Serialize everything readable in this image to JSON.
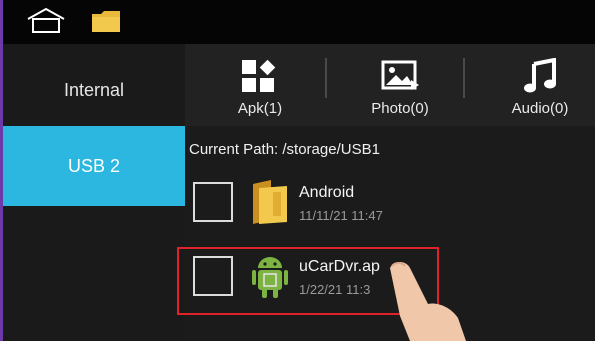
{
  "sidebar": {
    "items": [
      {
        "label": "Internal"
      },
      {
        "label": "USB 2"
      }
    ]
  },
  "categories": [
    {
      "label": "Apk(1)",
      "icon": "apk-grid-icon"
    },
    {
      "label": "Photo(0)",
      "icon": "photo-icon"
    },
    {
      "label": "Audio(0)",
      "icon": "music-note-icon"
    }
  ],
  "path": "Current Path: /storage/USB1",
  "files": [
    {
      "name": "Android",
      "date": "11/11/21 11:47",
      "icon": "folder-icon"
    },
    {
      "name": "uCarDvr.ap",
      "date": "1/22/21 11:3",
      "icon": "android-apk-icon"
    }
  ],
  "colors": {
    "accent": "#2bb7df",
    "highlight": "#e0232a",
    "folder": "#e8b93a",
    "android": "#7cb342"
  }
}
